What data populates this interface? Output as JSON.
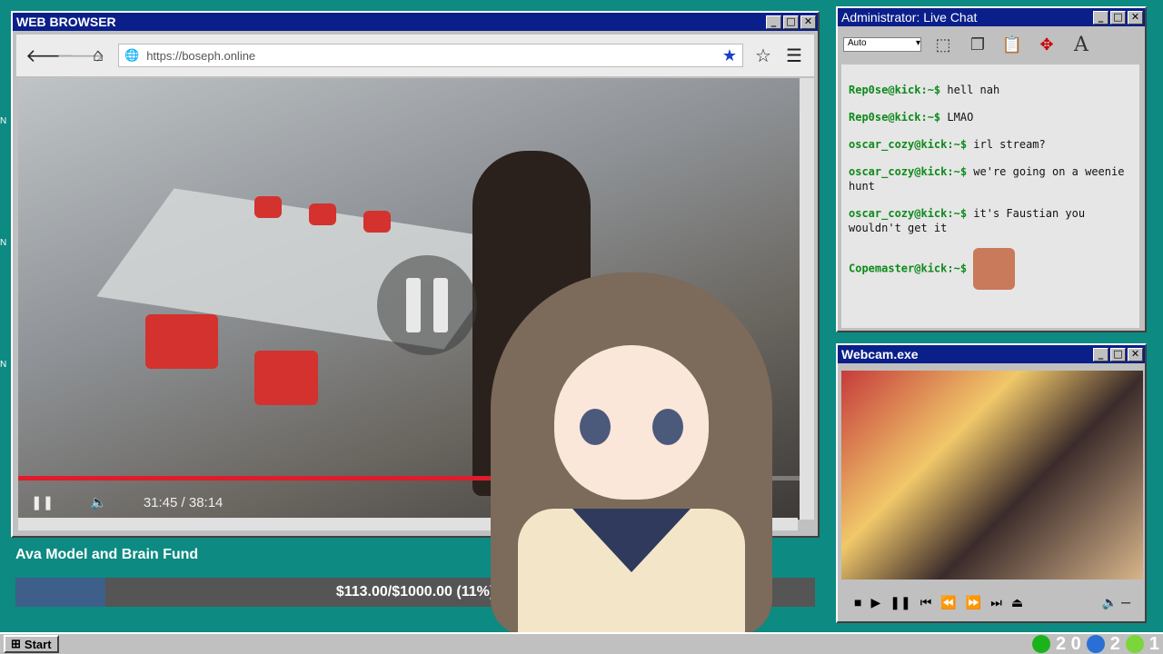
{
  "browser": {
    "title": "WEB BROWSER",
    "url": "https://boseph.online",
    "video": {
      "time": "31:45 / 38:14",
      "progress": 0.64
    }
  },
  "chat": {
    "title": "Administrator: Live Chat",
    "font_select": "Auto",
    "messages": [
      {
        "user": "Rep0se@kick:~$",
        "text": "hell nah"
      },
      {
        "user": "Rep0se@kick:~$",
        "text": "LMAO"
      },
      {
        "user": "oscar_cozy@kick:~$",
        "text": "irl stream?"
      },
      {
        "user": "oscar_cozy@kick:~$",
        "text": "we're going on a weenie hunt"
      },
      {
        "user": "oscar_cozy@kick:~$",
        "text": "it's Faustian you wouldn't get it"
      },
      {
        "user": "Copemaster@kick:~$",
        "text": ""
      }
    ]
  },
  "webcam": {
    "title": "Webcam.exe"
  },
  "fund": {
    "title": "Ava Model and Brain Fund",
    "amount_text": "$113.00/$1000.00 (11%)",
    "progress": 0.113
  },
  "taskbar": {
    "start_label": "Start",
    "tray_1": "2 0",
    "tray_2": "2",
    "tray_3": "1"
  },
  "colors": {
    "desktop": "#0d8a82",
    "titlebar": "#0a1f8a",
    "chat_user": "#0d8a1a",
    "video_progress": "#e01b2b"
  }
}
